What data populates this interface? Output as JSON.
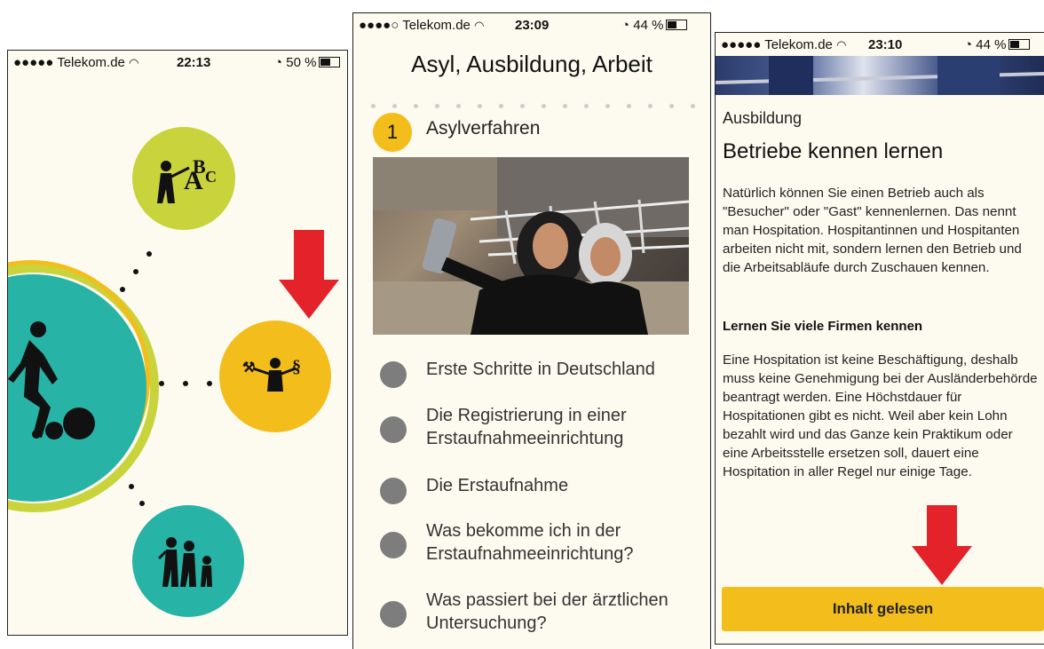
{
  "screen1": {
    "status": {
      "carrier": "●●●●● Telekom.de",
      "time": "22:13",
      "battery": "50 %"
    },
    "icons": [
      "alphabet-learning-icon",
      "law-work-icon",
      "family-icon",
      "football-person-icon"
    ],
    "colors": {
      "green": "#c9d33c",
      "teal": "#27b3a6",
      "yellow": "#f3bd1b",
      "arrow": "#e3222a"
    }
  },
  "screen2": {
    "status": {
      "carrier": "●●●●○ Telekom.de",
      "time": "23:09",
      "battery": "44 %"
    },
    "title": "Asyl, Ausbildung, Arbeit",
    "current_step": {
      "number": "1",
      "label": "Asylverfahren"
    },
    "items": [
      {
        "label": "Erste Schritte in Deutschland"
      },
      {
        "label": "Die Registrierung in einer Erstaufnahmeeinrichtung"
      },
      {
        "label": "Die Erstaufnahme"
      },
      {
        "label": "Was bekomme ich in der Erstaufnahmeeinrichtung?"
      },
      {
        "label": "Was passiert bei der ärztlichen Untersuchung?"
      }
    ]
  },
  "screen3": {
    "status": {
      "carrier": "●●●●● Telekom.de",
      "time": "23:10",
      "battery": "44 %"
    },
    "section": "Ausbildung",
    "heading": "Betriebe kennen lernen",
    "paragraph1": "Natürlich können Sie einen Betrieb auch als \"Besucher\" oder \"Gast\" kennenlernen. Das nennt man Hospitation. Hospitantinnen und Hospitanten arbeiten nicht mit, sondern lernen den Betrieb und die Arbeitsabläufe durch Zuschauen kennen.",
    "subheading": "Lernen Sie viele Firmen kennen",
    "paragraph2": "Eine Hospitation ist keine Beschäftigung, deshalb muss keine Genehmigung bei der Ausländerbehörde beantragt werden. Eine Höchstdauer für Hospitationen gibt es nicht. Weil aber kein Lohn bezahlt wird und das Ganze kein Praktikum oder eine Arbeitsstelle ersetzen soll, dauert eine Hospitation in aller Regel nur einige Tage.",
    "button": "Inhalt gelesen"
  }
}
